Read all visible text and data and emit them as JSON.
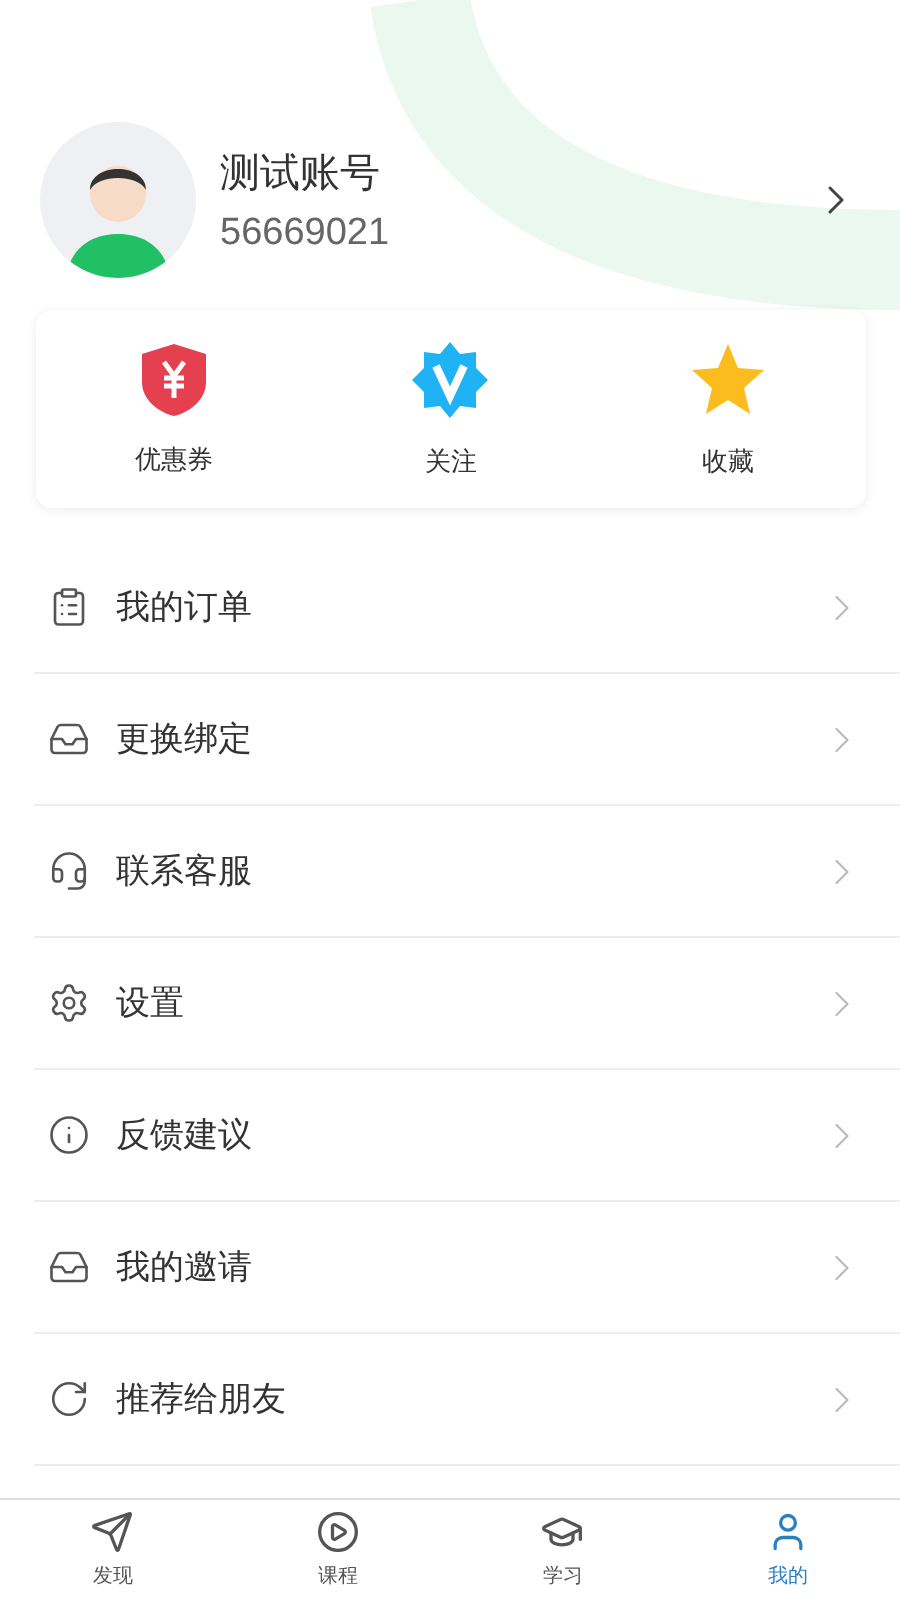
{
  "profile": {
    "name": "测试账号",
    "account_id": "56669021"
  },
  "shortcuts": [
    {
      "label": "优惠券"
    },
    {
      "label": "关注"
    },
    {
      "label": "收藏"
    }
  ],
  "menu": [
    {
      "label": "我的订单"
    },
    {
      "label": "更换绑定"
    },
    {
      "label": "联系客服"
    },
    {
      "label": "设置"
    },
    {
      "label": "反馈建议"
    },
    {
      "label": "我的邀请"
    },
    {
      "label": "推荐给朋友"
    }
  ],
  "tab_bar": [
    {
      "label": "发现",
      "selected": false
    },
    {
      "label": "课程",
      "selected": false
    },
    {
      "label": "学习",
      "selected": false
    },
    {
      "label": "我的",
      "selected": true
    }
  ]
}
